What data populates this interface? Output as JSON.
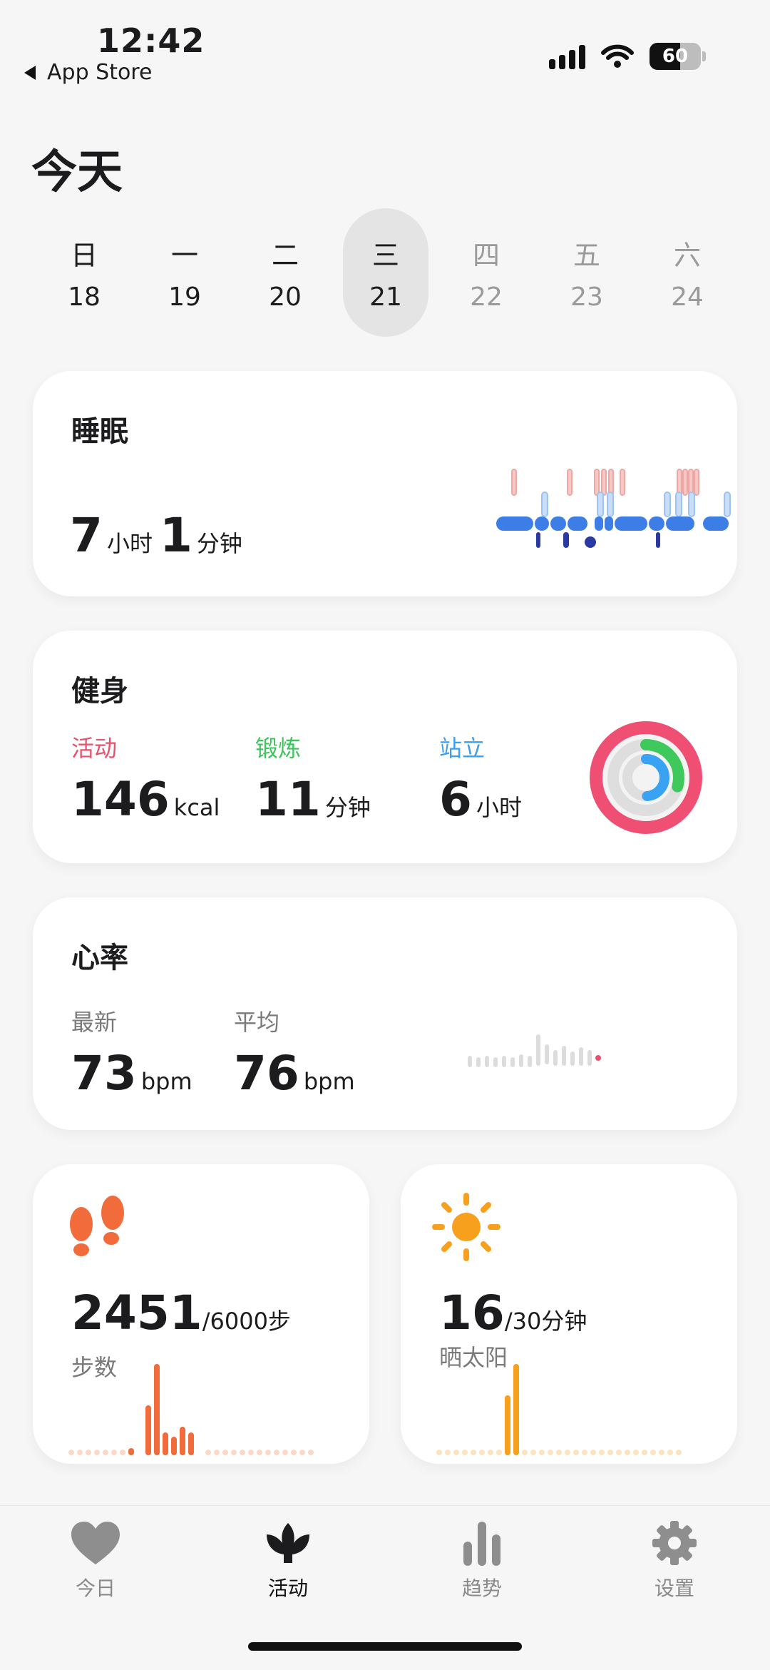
{
  "status": {
    "time": "12:42",
    "back_label": "App Store",
    "battery": "60"
  },
  "title": "今天",
  "week": [
    {
      "name": "日",
      "date": "18",
      "state": "past"
    },
    {
      "name": "一",
      "date": "19",
      "state": "past"
    },
    {
      "name": "二",
      "date": "20",
      "state": "past"
    },
    {
      "name": "三",
      "date": "21",
      "state": "selected"
    },
    {
      "name": "四",
      "date": "22",
      "state": "future"
    },
    {
      "name": "五",
      "date": "23",
      "state": "future"
    },
    {
      "name": "六",
      "date": "24",
      "state": "future"
    }
  ],
  "sleep": {
    "title": "睡眠",
    "hours": "7",
    "hours_unit": "小时",
    "minutes": "1",
    "minutes_unit": "分钟"
  },
  "fitness": {
    "title": "健身",
    "activity": {
      "label": "活动",
      "value": "146",
      "unit": "kcal",
      "color": "#e9506d"
    },
    "exercise": {
      "label": "锻炼",
      "value": "11",
      "unit": "分钟",
      "color": "#3dc45b"
    },
    "stand": {
      "label": "站立",
      "value": "6",
      "unit": "小时",
      "color": "#3a9ff0"
    }
  },
  "heart": {
    "title": "心率",
    "latest": {
      "label": "最新",
      "value": "73",
      "unit": "bpm"
    },
    "average": {
      "label": "平均",
      "value": "76",
      "unit": "bpm"
    }
  },
  "steps": {
    "value": "2451",
    "goal": "/6000步",
    "label": "步数",
    "color": "#f26b3a"
  },
  "sun": {
    "value": "16",
    "goal": "/30分钟",
    "label": "晒太阳",
    "color": "#f7a01d"
  },
  "tabs": [
    {
      "label": "今日",
      "icon": "heart-icon"
    },
    {
      "label": "活动",
      "icon": "flower-icon"
    },
    {
      "label": "趋势",
      "icon": "bars-icon"
    },
    {
      "label": "设置",
      "icon": "gear-icon"
    }
  ]
}
